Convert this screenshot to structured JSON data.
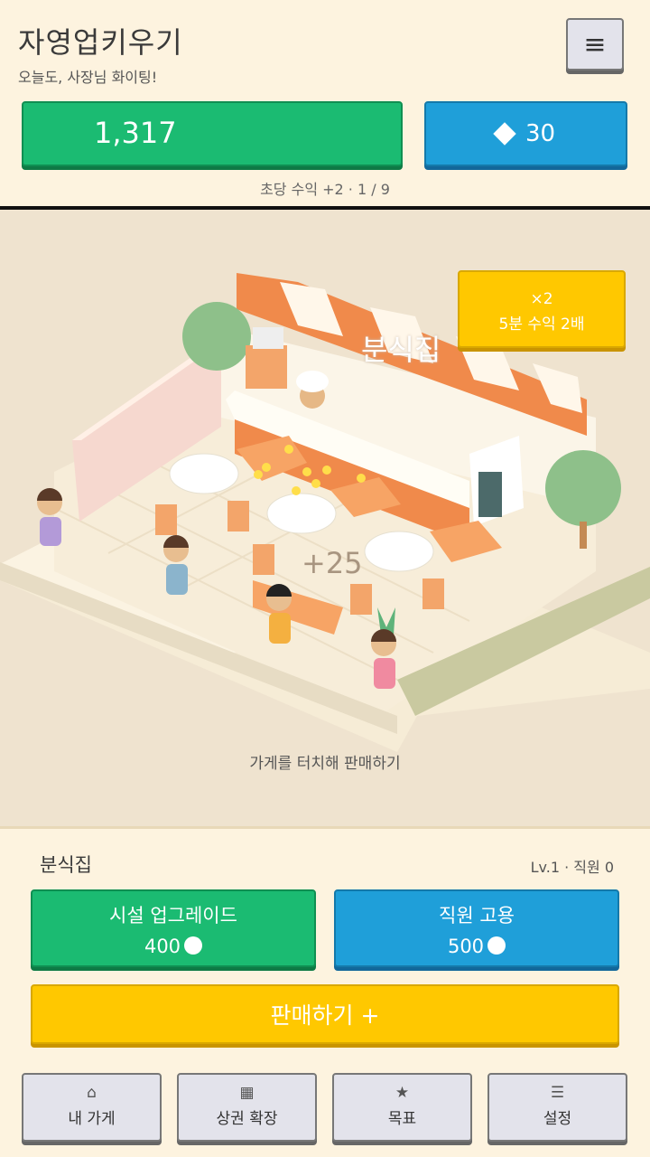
{
  "header": {
    "title": "자영업키우기",
    "subtitle": "오늘도, 사장님 화이팅!",
    "menu_icon": "≡",
    "coins": "1,317",
    "gems": "30",
    "rate_text": "초당 수익 +2 · 1 / 9"
  },
  "scene": {
    "boost_multiplier": "×2",
    "boost_label": "5분 수익 2배",
    "shop_sign": "분식집",
    "earn_float": "+25",
    "touch_hint": "가게를 터치해 판매하기"
  },
  "panel": {
    "shop_name": "분식집",
    "shop_level": "Lv.1 · 직원 0",
    "upgrade_label": "시설 업그레이드",
    "upgrade_cost": "400",
    "hire_label": "직원 고용",
    "hire_cost": "500",
    "sell_label": "판매하기 +"
  },
  "nav": [
    {
      "icon": "⌂",
      "label": "내 가게"
    },
    {
      "icon": "▦",
      "label": "상권 확장"
    },
    {
      "icon": "★",
      "label": "목표"
    },
    {
      "icon": "☰",
      "label": "설정"
    }
  ],
  "colors": {
    "background": "#fdf3df",
    "green": "#1bbb72",
    "blue": "#1f9fd9",
    "yellow": "#ffc800"
  }
}
